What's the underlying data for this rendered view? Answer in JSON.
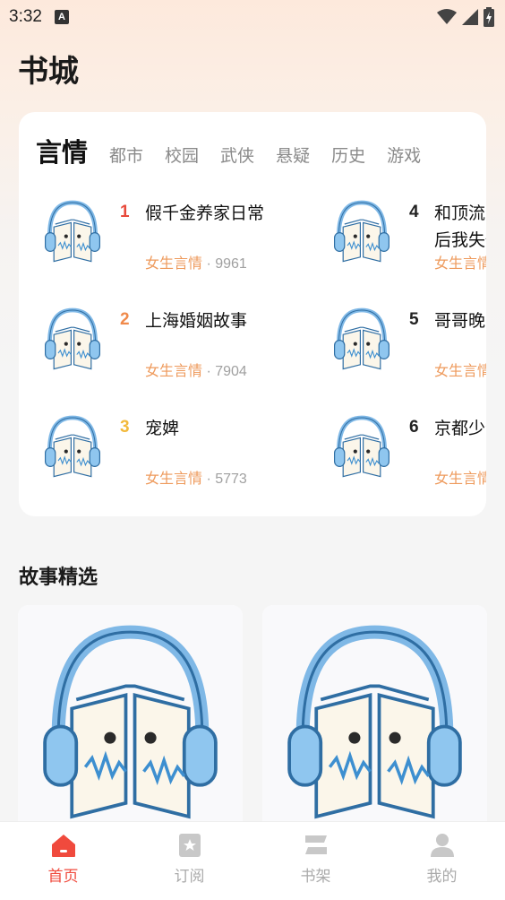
{
  "status_bar": {
    "time": "3:32",
    "badge": "A"
  },
  "page_title": "书城",
  "rank": {
    "active_tab": "言情",
    "tabs": [
      "都市",
      "校园",
      "武侠",
      "悬疑",
      "历史",
      "游戏"
    ],
    "items": [
      {
        "rank": "1",
        "title": "假千金养家日常",
        "category": "女生言情",
        "count": "9961",
        "rank_color": "#e84a3c"
      },
      {
        "rank": "2",
        "title": "上海婚姻故事",
        "category": "女生言情",
        "count": "7904",
        "rank_color": "#f08a4b"
      },
      {
        "rank": "3",
        "title": "宠婢",
        "category": "女生言情",
        "count": "5773",
        "rank_color": "#f2b93b"
      },
      {
        "rank": "4",
        "title": "和顶流分手后我失忆了",
        "category": "女生言情",
        "count": "",
        "rank_color": "#222222"
      },
      {
        "rank": "5",
        "title": "哥哥晚安",
        "category": "女生言情",
        "count": "",
        "rank_color": "#222222"
      },
      {
        "rank": "6",
        "title": "京都少爷",
        "category": "女生言情",
        "count": "",
        "rank_color": "#222222"
      }
    ]
  },
  "stories": {
    "title": "故事精选"
  },
  "tabbar": {
    "items": [
      {
        "label": "首页",
        "icon": "home-icon",
        "active": true
      },
      {
        "label": "订阅",
        "icon": "subscribe-icon",
        "active": false
      },
      {
        "label": "书架",
        "icon": "bookshelf-icon",
        "active": false
      },
      {
        "label": "我的",
        "icon": "profile-icon",
        "active": false
      }
    ]
  },
  "colors": {
    "accent": "#f04a3d",
    "category": "#ee9a5c"
  }
}
